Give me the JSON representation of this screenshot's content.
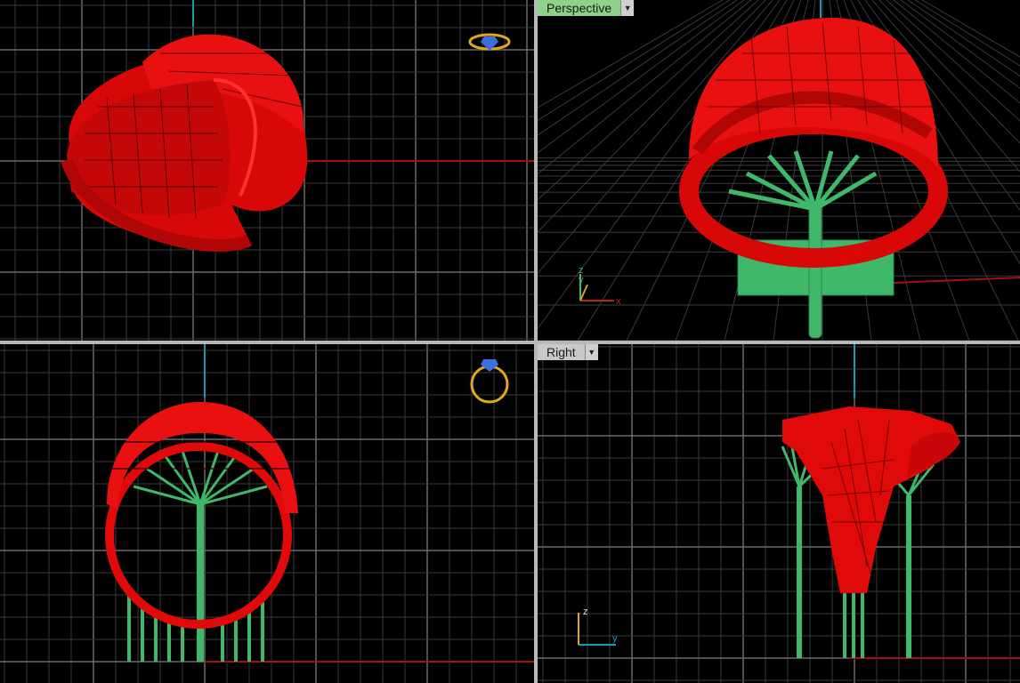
{
  "viewports": {
    "top": {
      "label": ""
    },
    "perspective": {
      "label": "Perspective",
      "active": true,
      "menu_icon": "dropdown-arrow-icon"
    },
    "front": {
      "label": ""
    },
    "right": {
      "label": "Right",
      "active": false,
      "menu_icon": "dropdown-arrow-icon"
    }
  },
  "axis_labels": {
    "perspective": {
      "z": "z",
      "y": "y",
      "x": "x"
    },
    "right": {
      "z": "z",
      "y": "y"
    }
  },
  "colors": {
    "background": "#000000",
    "grid_minor": "#3a3a3a",
    "grid_major": "#6a6a6a",
    "model": "#e60a0a",
    "supports": "#3fb86a",
    "x_axis": "#a31010",
    "vertical_axis": "#1a9aa8",
    "active_label_bg": "#8fd08a",
    "inactive_label_bg": "#c9c9c9",
    "gumball_icon": "#e0a81c"
  }
}
